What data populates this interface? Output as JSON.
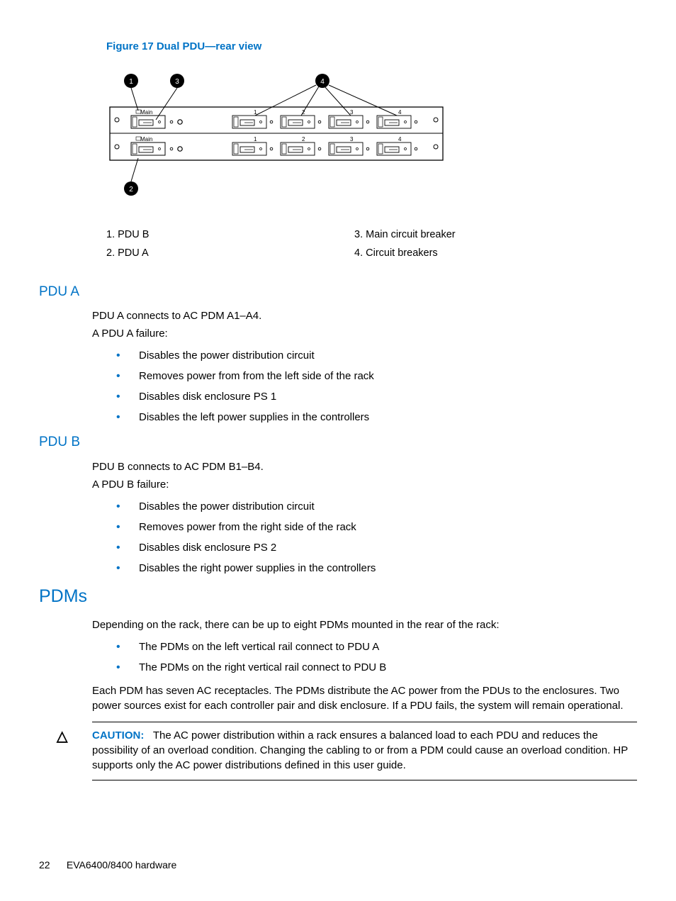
{
  "figure": {
    "title": "Figure 17 Dual PDU—rear view",
    "callouts": [
      "1",
      "2",
      "3",
      "4"
    ],
    "row_label": "Main",
    "slot_labels": [
      "1",
      "2",
      "3",
      "4"
    ]
  },
  "legend": {
    "left": [
      {
        "num": "1.",
        "text": "PDU B"
      },
      {
        "num": "2.",
        "text": "PDU A"
      }
    ],
    "right": [
      {
        "num": "3.",
        "text": "Main circuit breaker"
      },
      {
        "num": "4.",
        "text": "Circuit breakers"
      }
    ]
  },
  "pdu_a": {
    "heading": "PDU A",
    "p1": "PDU A connects to AC PDM A1–A4.",
    "p2": "A PDU A failure:",
    "bullets": [
      "Disables the power distribution circuit",
      "Removes power from from the left side of the rack",
      "Disables disk enclosure PS 1",
      "Disables the left power supplies in the controllers"
    ]
  },
  "pdu_b": {
    "heading": "PDU B",
    "p1": "PDU B connects to AC PDM B1–B4.",
    "p2": "A PDU B failure:",
    "bullets": [
      "Disables the power distribution circuit",
      "Removes power from the right side of the rack",
      "Disables disk enclosure PS 2",
      "Disables the right power supplies in the controllers"
    ]
  },
  "pdms": {
    "heading": "PDMs",
    "p1": "Depending on the rack, there can be up to eight PDMs mounted in the rear of the rack:",
    "bullets": [
      "The PDMs on the left vertical rail connect to PDU A",
      "The PDMs on the right vertical rail connect to PDU B"
    ],
    "p2": "Each PDM has seven AC receptacles. The PDMs distribute the AC power from the PDUs to the enclosures. Two power sources exist for each controller pair and disk enclosure. If a PDU fails, the system will remain operational."
  },
  "caution": {
    "label": "CAUTION:",
    "text": "The AC power distribution within a rack ensures a balanced load to each PDU and reduces the possibility of an overload condition. Changing the cabling to or from a PDM could cause an overload condition. HP supports only the AC power distributions defined in this user guide."
  },
  "footer": {
    "page": "22",
    "title": "EVA6400/8400 hardware"
  }
}
